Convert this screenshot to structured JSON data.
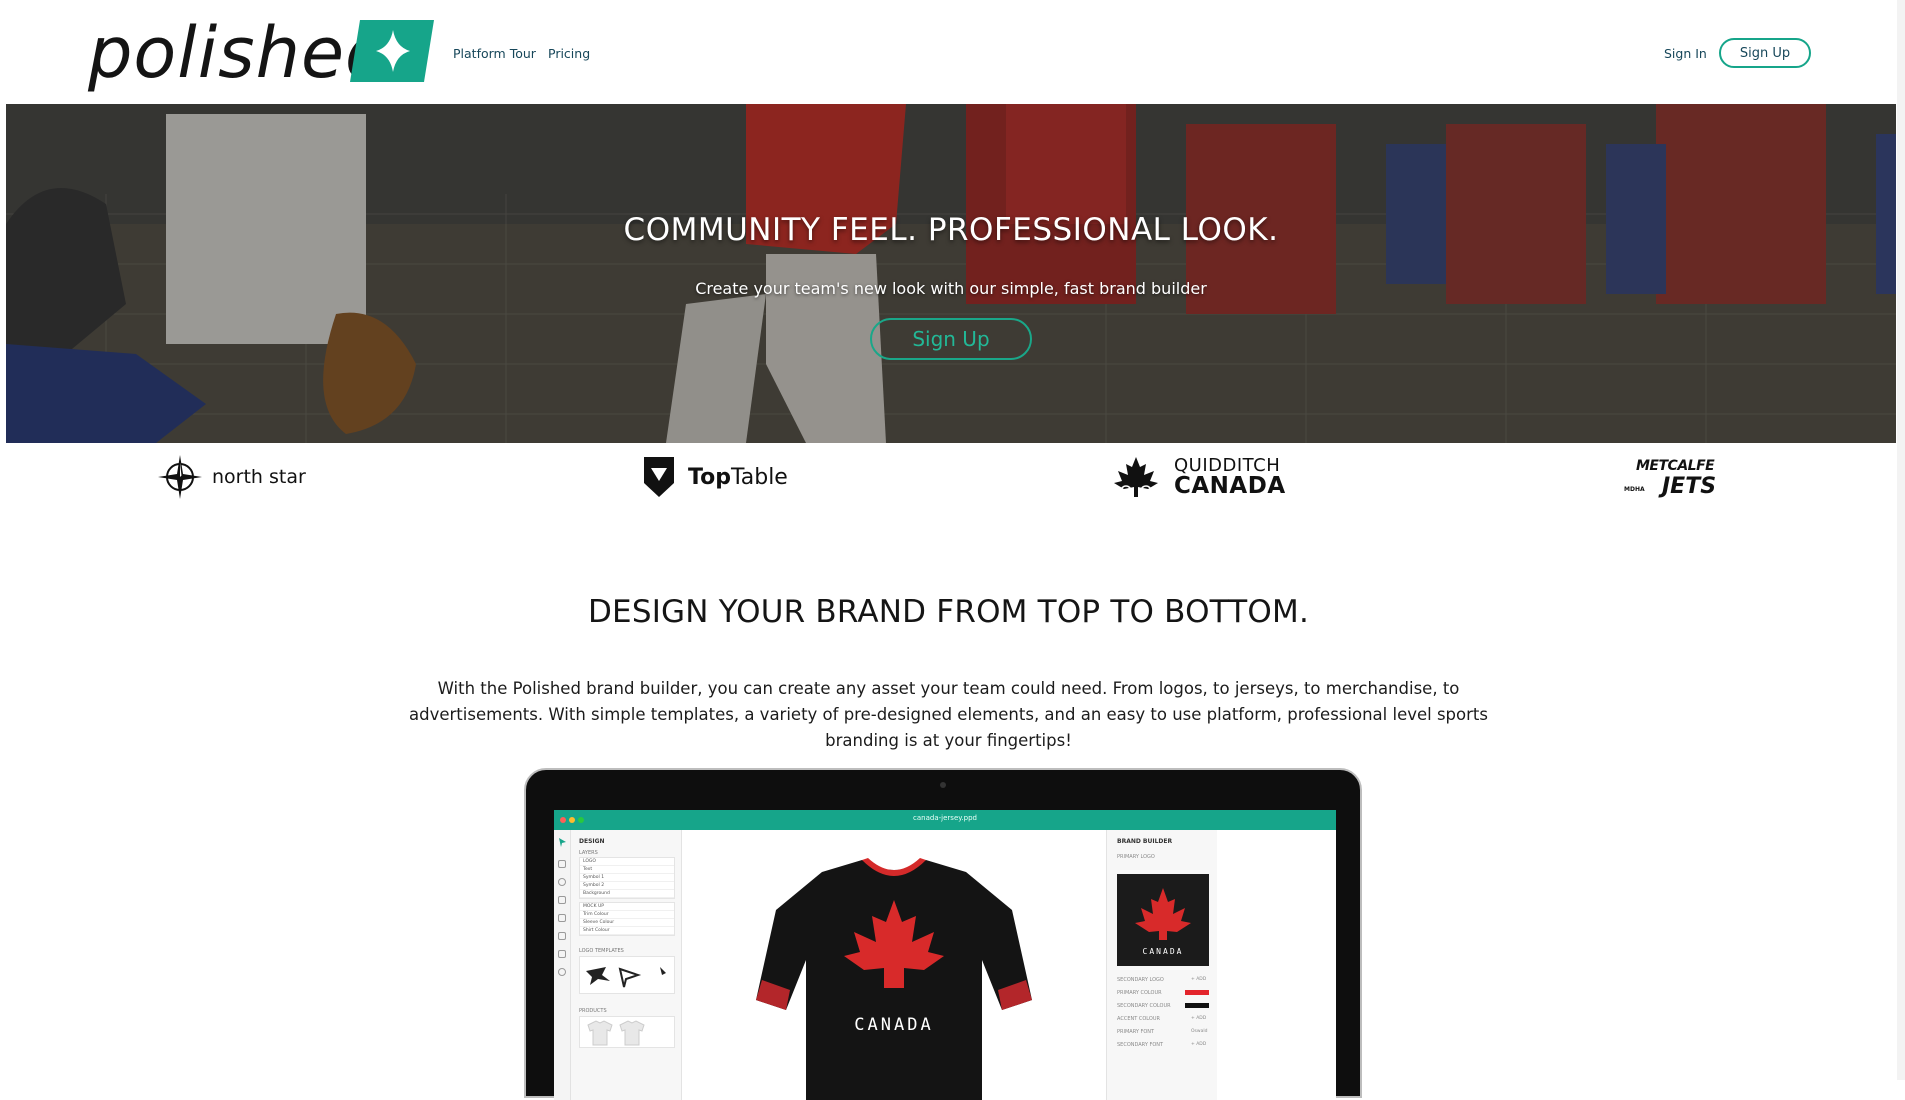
{
  "header": {
    "logo_text": "polished",
    "nav": [
      "Platform Tour",
      "Pricing"
    ],
    "sign_in": "Sign In",
    "sign_up": "Sign Up",
    "brand_color": "#16a58a"
  },
  "hero": {
    "title": "COMMUNITY FEEL. PROFESSIONAL LOOK.",
    "subtitle": "Create your team's new look with our simple, fast brand builder",
    "cta": "Sign Up"
  },
  "partners": {
    "north_star": "north star",
    "top": "Top",
    "table": "Table",
    "quidditch": "QUIDDITCH",
    "canada": "CANADA",
    "metcalfe": "METCALFE",
    "jets": "JETS",
    "mdha": "MDHA"
  },
  "design_section": {
    "title": "DESIGN YOUR BRAND FROM TOP TO BOTTOM.",
    "body": "With the Polished brand builder, you can create any asset your team could need. From logos, to jerseys, to merchandise, to advertisements. With simple templates, a variety of pre-designed elements, and an easy to use platform, professional level sports branding is at your fingertips!"
  },
  "app": {
    "file_name": "canada-jersey.ppd",
    "left": {
      "design": "DESIGN",
      "layers": "LAYERS",
      "layer_rows": [
        "LOGO",
        "Text",
        "Symbol 1",
        "Symbol 2",
        "Background"
      ],
      "mockup": "MOCK UP",
      "mock_rows": [
        "Trim Colour",
        "Sleeve Colour",
        "Shirt Colour"
      ],
      "logo_templates": "LOGO TEMPLATES",
      "products": "PRODUCTS"
    },
    "right": {
      "brand_builder": "BRAND BUILDER",
      "primary_logo": "PRIMARY LOGO",
      "logo_text": "CANADA",
      "rows": [
        {
          "label": "SECONDARY LOGO",
          "action": "+ ADD"
        },
        {
          "label": "PRIMARY COLOUR",
          "swatch": "#e3242b"
        },
        {
          "label": "SECONDARY COLOUR",
          "swatch": "#111111"
        },
        {
          "label": "ACCENT COLOUR",
          "action": "+ ADD"
        },
        {
          "label": "PRIMARY FONT",
          "action": "Oswald"
        },
        {
          "label": "SECONDARY FONT",
          "action": "+ ADD"
        }
      ]
    },
    "jersey_text": "CANADA"
  }
}
